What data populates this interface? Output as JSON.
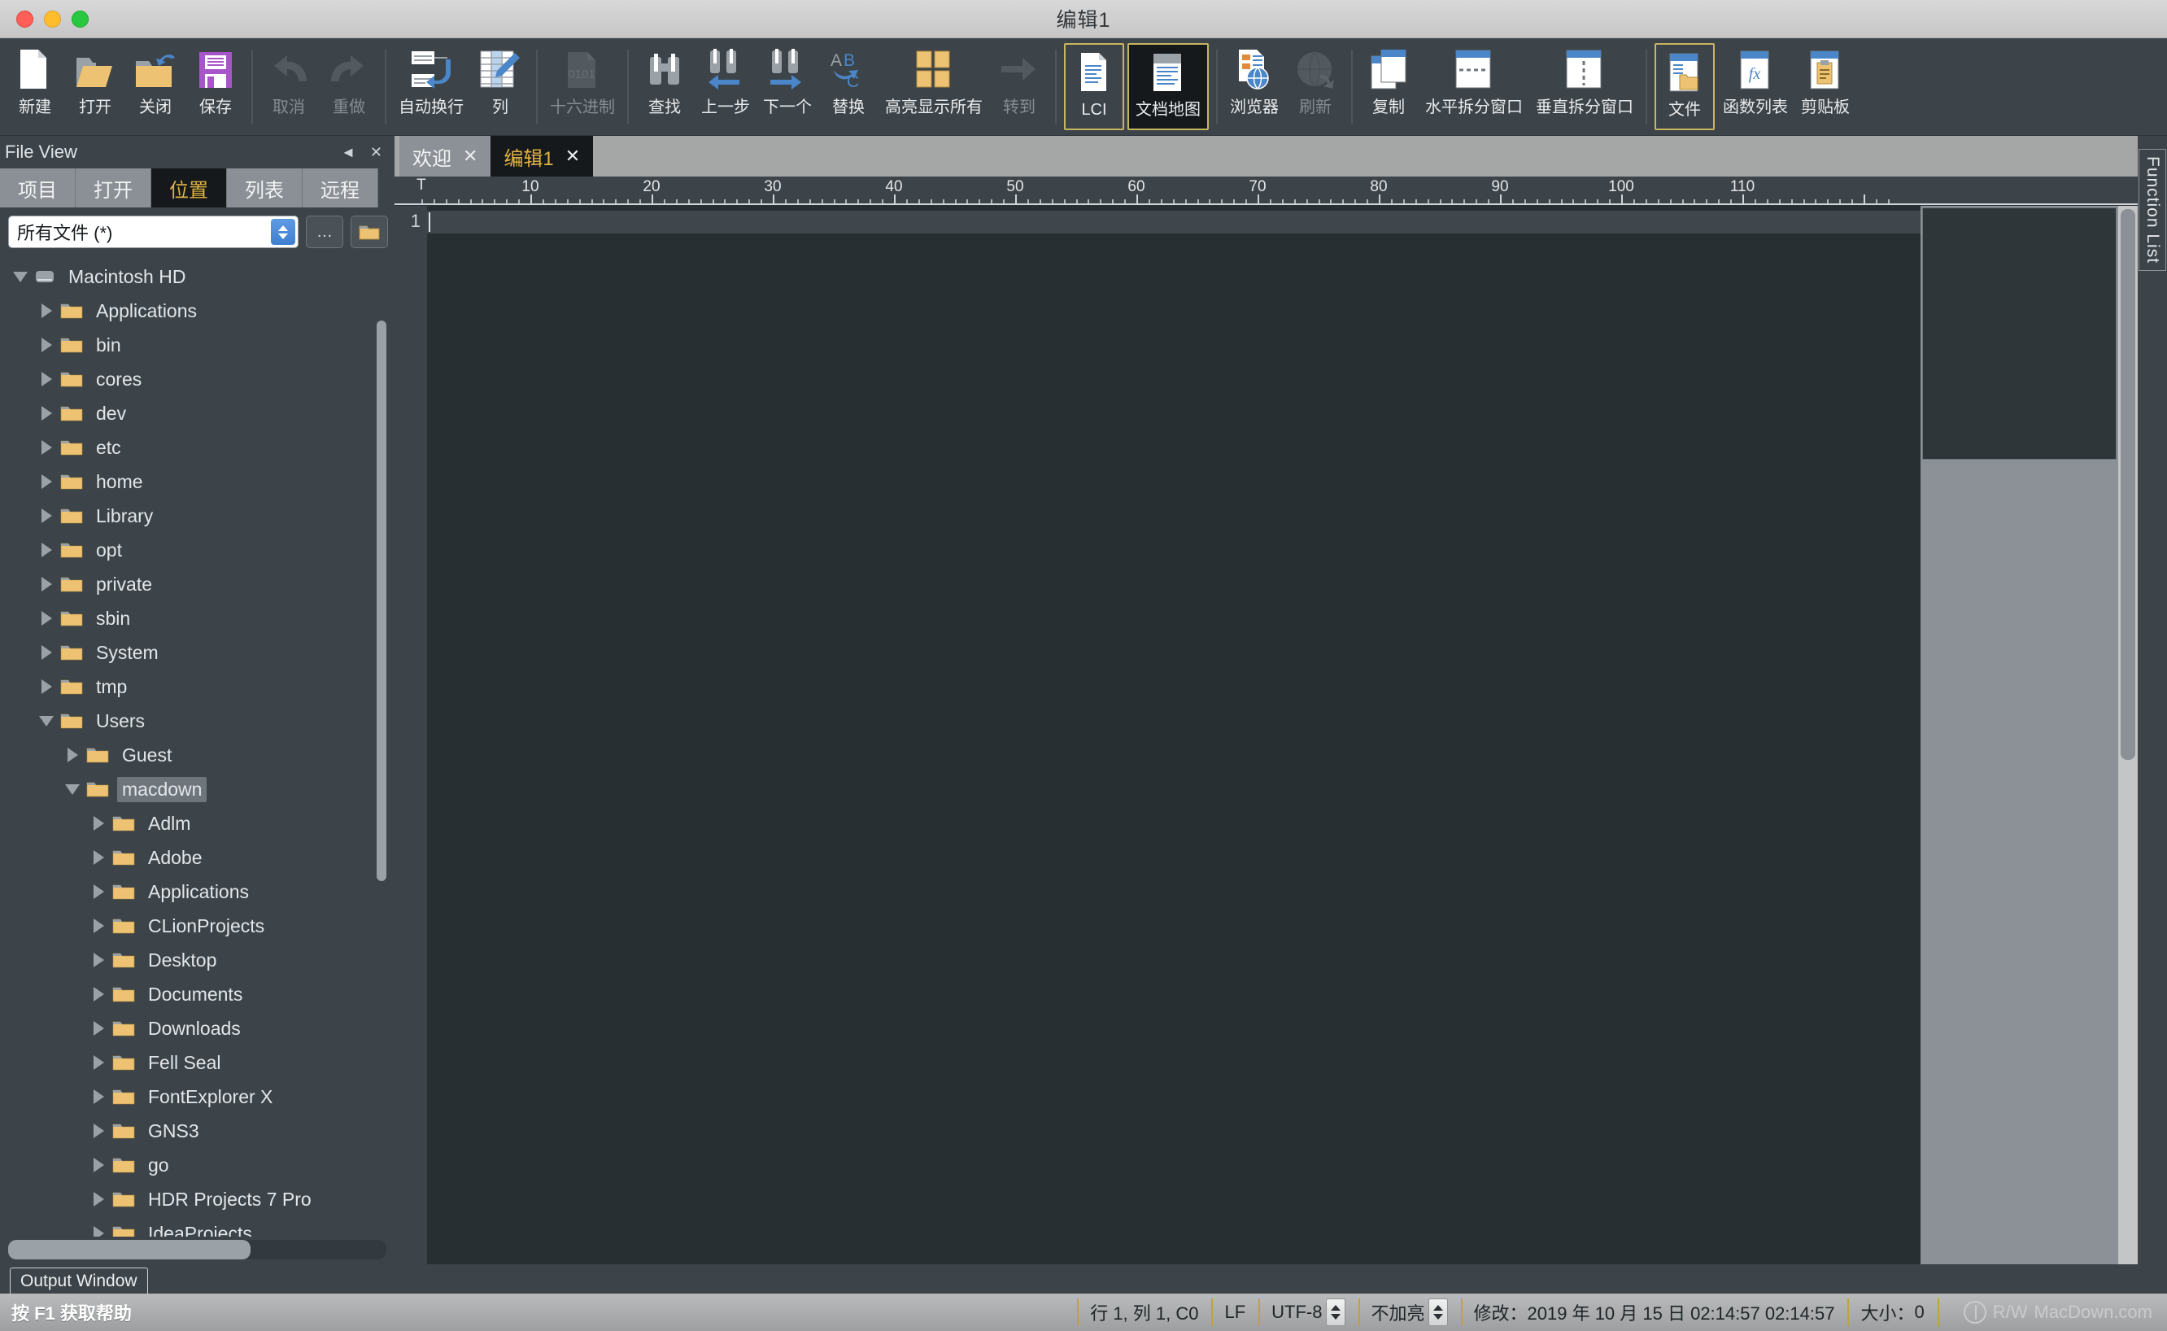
{
  "window": {
    "title": "编辑1",
    "controls": [
      "close",
      "minimize",
      "zoom"
    ]
  },
  "toolbar": {
    "buttons": [
      {
        "label": "新建",
        "icon": "new-file-icon",
        "state": "enabled"
      },
      {
        "label": "打开",
        "icon": "open-folder-icon",
        "state": "enabled"
      },
      {
        "label": "关闭",
        "icon": "close-folder-icon",
        "state": "enabled"
      },
      {
        "label": "保存",
        "icon": "save-floppy-icon",
        "state": "enabled"
      },
      {
        "label": "取消",
        "icon": "undo-icon",
        "state": "disabled"
      },
      {
        "label": "重做",
        "icon": "redo-icon",
        "state": "disabled"
      },
      {
        "label": "自动换行",
        "icon": "word-wrap-icon",
        "state": "enabled"
      },
      {
        "label": "列",
        "icon": "column-edit-icon",
        "state": "enabled"
      },
      {
        "label": "十六进制",
        "icon": "hex-0101-icon",
        "state": "disabled"
      },
      {
        "label": "查找",
        "icon": "binoculars-icon",
        "state": "enabled"
      },
      {
        "label": "上一步",
        "icon": "find-previous-icon",
        "state": "enabled"
      },
      {
        "label": "下一个",
        "icon": "find-next-icon",
        "state": "enabled"
      },
      {
        "label": "替换",
        "icon": "replace-ab-ac-icon",
        "state": "enabled"
      },
      {
        "label": "高亮显示所有",
        "icon": "highlight-all-icon",
        "state": "enabled"
      },
      {
        "label": "转到",
        "icon": "goto-arrow-icon",
        "state": "disabled"
      },
      {
        "label": "LCI",
        "icon": "lci-document-icon",
        "state": "framed"
      },
      {
        "label": "文档地图",
        "icon": "document-map-icon",
        "state": "framed-active"
      },
      {
        "label": "浏览器",
        "icon": "browser-globe-icon",
        "state": "enabled"
      },
      {
        "label": "刷新",
        "icon": "refresh-globe-icon",
        "state": "disabled"
      },
      {
        "label": "复制",
        "icon": "duplicate-window-icon",
        "state": "enabled"
      },
      {
        "label": "水平拆分窗口",
        "icon": "split-horizontal-icon",
        "state": "enabled"
      },
      {
        "label": "垂直拆分窗口",
        "icon": "split-vertical-icon",
        "state": "enabled"
      },
      {
        "label": "文件",
        "icon": "file-view-icon",
        "state": "framed"
      },
      {
        "label": "函数列表",
        "icon": "function-list-fx-icon",
        "state": "enabled"
      },
      {
        "label": "剪贴板",
        "icon": "clipboard-icon",
        "state": "enabled"
      }
    ],
    "separator_after": [
      3,
      5,
      7,
      8,
      14,
      16,
      18,
      21
    ]
  },
  "dock": {
    "title": "File View",
    "collapse_icon": "collapse-left-icon",
    "close_icon": "close-icon",
    "tabs": [
      {
        "label": "项目",
        "active": false
      },
      {
        "label": "打开",
        "active": false
      },
      {
        "label": "位置",
        "active": true
      },
      {
        "label": "列表",
        "active": false
      },
      {
        "label": "远程",
        "active": false
      }
    ],
    "filter": {
      "value": "所有文件 (*)",
      "dots_button": "…",
      "folder_button": "folder-icon"
    },
    "tree": [
      {
        "label": "Macintosh HD",
        "depth": 0,
        "expanded": true,
        "icon": "hard-drive-icon",
        "selected": false
      },
      {
        "label": "Applications",
        "depth": 1,
        "expanded": false,
        "icon": "folder-icon",
        "selected": false
      },
      {
        "label": "bin",
        "depth": 1,
        "expanded": false,
        "icon": "folder-icon",
        "selected": false
      },
      {
        "label": "cores",
        "depth": 1,
        "expanded": false,
        "icon": "folder-icon",
        "selected": false
      },
      {
        "label": "dev",
        "depth": 1,
        "expanded": false,
        "icon": "folder-icon",
        "selected": false
      },
      {
        "label": "etc",
        "depth": 1,
        "expanded": false,
        "icon": "folder-icon",
        "selected": false
      },
      {
        "label": "home",
        "depth": 1,
        "expanded": false,
        "icon": "folder-icon",
        "selected": false
      },
      {
        "label": "Library",
        "depth": 1,
        "expanded": false,
        "icon": "folder-icon",
        "selected": false
      },
      {
        "label": "opt",
        "depth": 1,
        "expanded": false,
        "icon": "folder-icon",
        "selected": false
      },
      {
        "label": "private",
        "depth": 1,
        "expanded": false,
        "icon": "folder-icon",
        "selected": false
      },
      {
        "label": "sbin",
        "depth": 1,
        "expanded": false,
        "icon": "folder-icon",
        "selected": false
      },
      {
        "label": "System",
        "depth": 1,
        "expanded": false,
        "icon": "folder-icon",
        "selected": false
      },
      {
        "label": "tmp",
        "depth": 1,
        "expanded": false,
        "icon": "folder-icon",
        "selected": false
      },
      {
        "label": "Users",
        "depth": 1,
        "expanded": true,
        "icon": "folder-icon",
        "selected": false
      },
      {
        "label": "Guest",
        "depth": 2,
        "expanded": false,
        "icon": "folder-icon",
        "selected": false
      },
      {
        "label": "macdown",
        "depth": 2,
        "expanded": true,
        "icon": "folder-icon",
        "selected": true
      },
      {
        "label": "Adlm",
        "depth": 3,
        "expanded": false,
        "icon": "folder-icon",
        "selected": false
      },
      {
        "label": "Adobe",
        "depth": 3,
        "expanded": false,
        "icon": "folder-icon",
        "selected": false
      },
      {
        "label": "Applications",
        "depth": 3,
        "expanded": false,
        "icon": "folder-icon",
        "selected": false
      },
      {
        "label": "CLionProjects",
        "depth": 3,
        "expanded": false,
        "icon": "folder-icon",
        "selected": false
      },
      {
        "label": "Desktop",
        "depth": 3,
        "expanded": false,
        "icon": "folder-icon",
        "selected": false
      },
      {
        "label": "Documents",
        "depth": 3,
        "expanded": false,
        "icon": "folder-icon",
        "selected": false
      },
      {
        "label": "Downloads",
        "depth": 3,
        "expanded": false,
        "icon": "folder-icon",
        "selected": false
      },
      {
        "label": "Fell Seal",
        "depth": 3,
        "expanded": false,
        "icon": "folder-icon",
        "selected": false
      },
      {
        "label": "FontExplorer X",
        "depth": 3,
        "expanded": false,
        "icon": "folder-icon",
        "selected": false
      },
      {
        "label": "GNS3",
        "depth": 3,
        "expanded": false,
        "icon": "folder-icon",
        "selected": false
      },
      {
        "label": "go",
        "depth": 3,
        "expanded": false,
        "icon": "folder-icon",
        "selected": false
      },
      {
        "label": "HDR Projects 7 Pro",
        "depth": 3,
        "expanded": false,
        "icon": "folder-icon",
        "selected": false
      },
      {
        "label": "IdeaProjects",
        "depth": 3,
        "expanded": false,
        "icon": "folder-icon",
        "selected": false
      }
    ]
  },
  "editor": {
    "tabs": [
      {
        "label": "欢迎",
        "active": false,
        "close_icon": "close-icon"
      },
      {
        "label": "编辑1",
        "active": true,
        "close_icon": "close-icon"
      }
    ],
    "ruler": {
      "tab_marker": "T",
      "numbers": [
        10,
        20,
        30,
        40,
        50,
        60,
        70,
        80,
        90,
        100,
        110
      ]
    },
    "line_numbers": [
      "1"
    ],
    "content": "",
    "right_panel_label": "Function List"
  },
  "bottom": {
    "output_tab": "Output Window",
    "hint": "按 F1 获取帮助"
  },
  "status": {
    "position": "行 1, 列 1, C0",
    "eol": "LF",
    "encoding": "UTF-8",
    "highlight": "不加亮",
    "modified_label": "修改：",
    "modified_value": "2019 年 10 月 15 日 02:14:57 02:14:57",
    "size_label": "大小：",
    "size_value": "0",
    "access": "R/W",
    "watermark": "MacDown.com"
  },
  "colors": {
    "accent_gold": "#e0b341",
    "toolbar_bg": "#3d4449",
    "editor_bg": "#282f33",
    "panel_bg": "#3c4449",
    "folder": "#edc373",
    "blue": "#4a86c8",
    "status_sep": "#c0a23c"
  }
}
